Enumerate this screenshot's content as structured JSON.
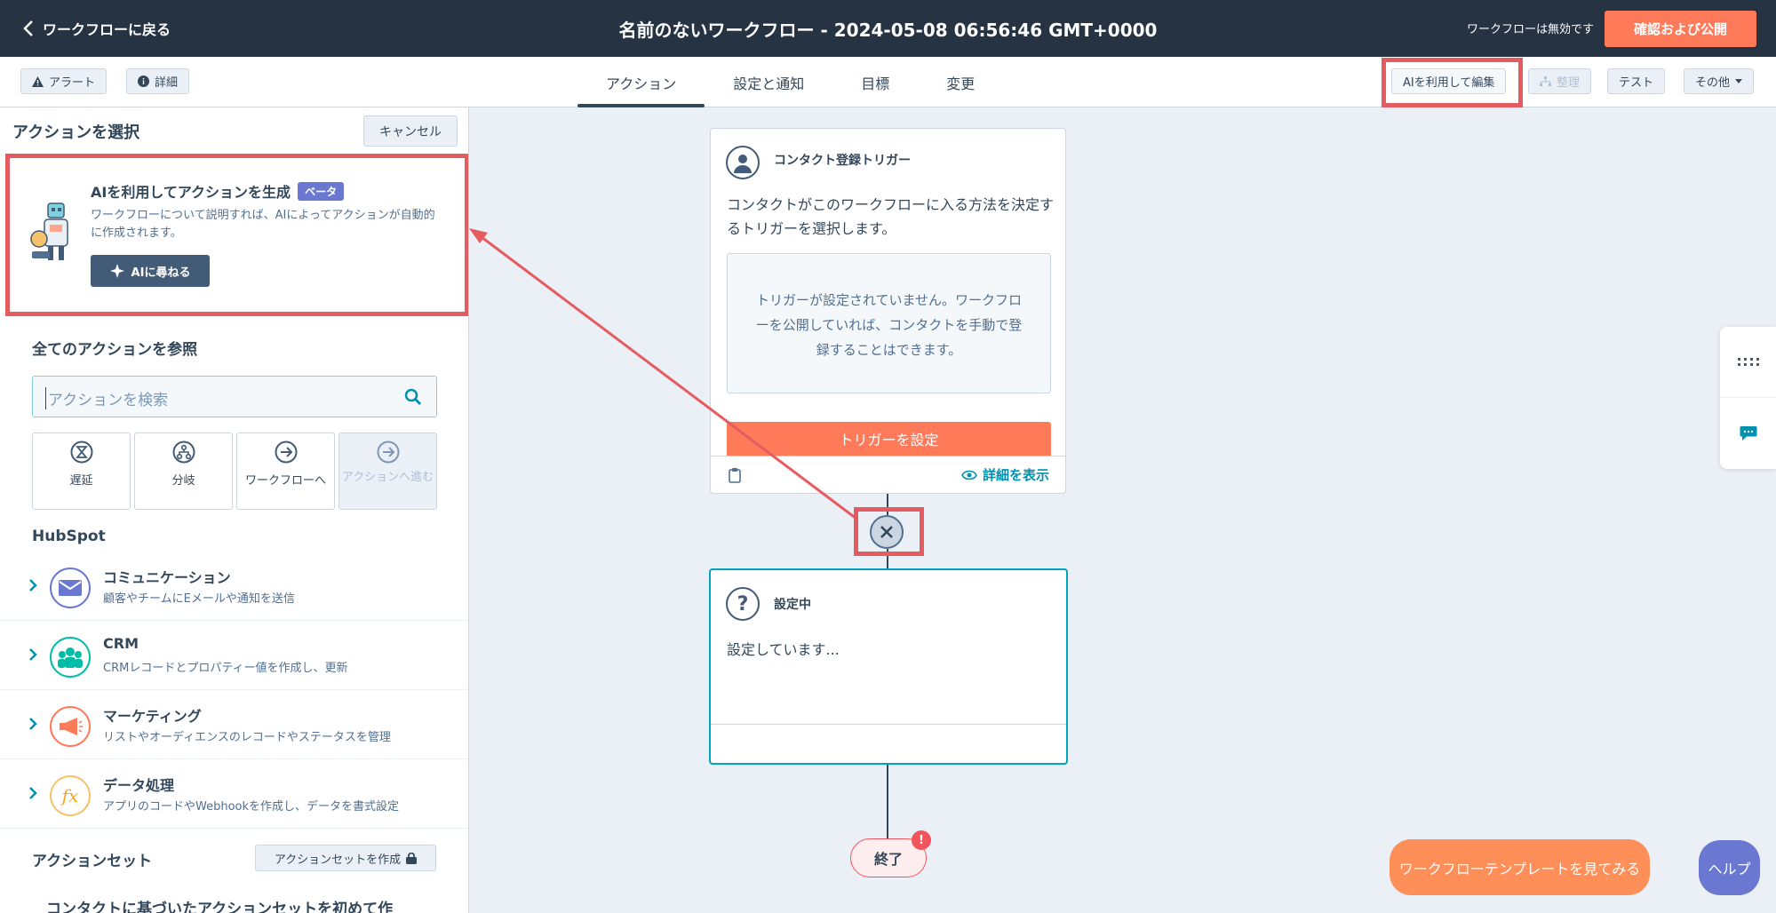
{
  "header": {
    "back_label": "ワークフローに戻る",
    "title": "名前のないワークフロー - 2024-05-08 06:56:46 GMT+0000",
    "status": "ワークフローは無効です",
    "publish_label": "確認および公開"
  },
  "toolbar": {
    "alert_label": "アラート",
    "details_label": "詳細",
    "tabs": [
      {
        "label": "アクション",
        "active": true
      },
      {
        "label": "設定と通知",
        "active": false
      },
      {
        "label": "目標",
        "active": false
      },
      {
        "label": "変更",
        "active": false
      }
    ],
    "ai_edit_label": "AIを利用して編集",
    "organize_label": "整理",
    "test_label": "テスト",
    "more_label": "その他"
  },
  "panel": {
    "title": "アクションを選択",
    "cancel_label": "キャンセル",
    "ai": {
      "heading": "AIを利用してアクションを生成",
      "badge": "ベータ",
      "description": "ワークフローについて説明すれば、AIによってアクションが自動的に作成されます。",
      "button_label": "AIに尋ねる"
    },
    "browse_heading": "全てのアクションを参照",
    "search_placeholder": "アクションを検索",
    "tiles": [
      {
        "label": "遅延",
        "icon": "hourglass-icon",
        "disabled": false
      },
      {
        "label": "分岐",
        "icon": "branch-icon",
        "disabled": false
      },
      {
        "label": "ワークフローへ",
        "icon": "arrow-right-circle-icon",
        "disabled": false
      },
      {
        "label": "アクションへ進む",
        "icon": "arrow-right-circle-icon",
        "disabled": true
      }
    ],
    "hubspot_heading": "HubSpot",
    "categories": [
      {
        "name": "コミュニケーション",
        "description": "顧客やチームにEメールや通知を送信",
        "icon": "envelope-icon",
        "color": "#6a78d1"
      },
      {
        "name": "CRM",
        "description": "CRMレコードとプロパティー値を作成し、更新",
        "icon": "people-icon",
        "color": "#00bda5"
      },
      {
        "name": "マーケティング",
        "description": "リストやオーディエンスのレコードやステータスを管理",
        "icon": "megaphone-icon",
        "color": "#ff7a59"
      },
      {
        "name": "データ処理",
        "description": "アプリのコードやWebhookを作成し、データを書式設定",
        "icon": "function-icon",
        "color": "#f5c26b"
      }
    ],
    "actionset_heading": "アクションセット",
    "actionset_button": "アクションセットを作成",
    "actionset_description": "コンタクトに基づいたアクションセットを初めて作"
  },
  "canvas": {
    "trigger": {
      "title": "コンタクト登録トリガー",
      "description": "コンタクトがこのワークフローに入る方法を決定するトリガーを選択します。",
      "empty_message": "トリガーが設定されていません。ワークフローを公開していれば、コンタクトを手動で登録することはできます。",
      "button_label": "トリガーを設定",
      "details_link": "詳細を表示"
    },
    "pending": {
      "title": "設定中",
      "body": "設定しています..."
    },
    "end_label": "終了",
    "end_badge": "!"
  },
  "floating": {
    "templates_label": "ワークフローテンプレートを見てみる",
    "help_label": "ヘルプ"
  },
  "colors": {
    "header_bg": "#253342",
    "accent": "#ff7a59",
    "highlight": "#e45c5f",
    "selected_border": "#00a4bd"
  }
}
